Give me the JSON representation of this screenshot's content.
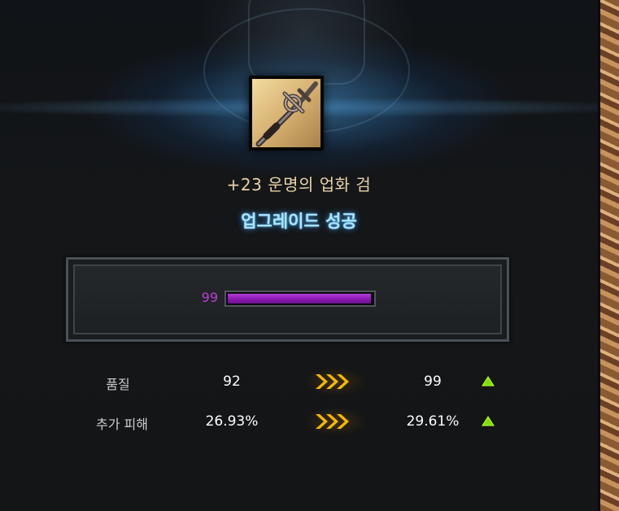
{
  "item": {
    "name": "+23 운명의 업화 검",
    "icon": "sword-icon"
  },
  "result": {
    "status": "업그레이드 성공"
  },
  "progress": {
    "value_label": "99",
    "fill_percent": 99,
    "color": "#9b26c4"
  },
  "stats": [
    {
      "label": "품질",
      "before": "92",
      "after": "99",
      "change": "increase"
    },
    {
      "label": "추가 피해",
      "before": "26.93%",
      "after": "29.61%",
      "change": "increase"
    }
  ],
  "colors": {
    "increase_arrow": "#7fe000",
    "transition_arrow": "#f5b400"
  }
}
